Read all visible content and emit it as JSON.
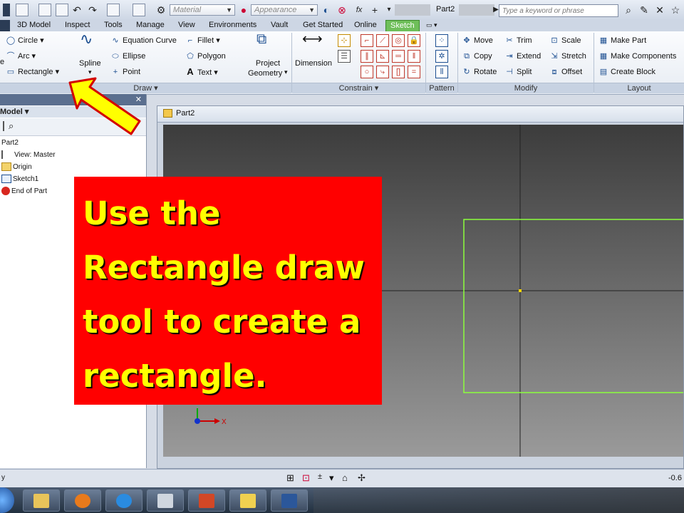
{
  "quick_access": {
    "material_placeholder": "Material",
    "appearance_placeholder": "Appearance",
    "document_title": "Part2",
    "search_placeholder": "Type a keyword or phrase",
    "fx_label": "fx"
  },
  "tabs": [
    {
      "label": "3D Model"
    },
    {
      "label": "Inspect"
    },
    {
      "label": "Tools"
    },
    {
      "label": "Manage"
    },
    {
      "label": "View"
    },
    {
      "label": "Environments"
    },
    {
      "label": "Vault"
    },
    {
      "label": "Get Started"
    },
    {
      "label": "Online"
    },
    {
      "label": "Sketch"
    }
  ],
  "ribbon": {
    "draw": {
      "e_label": "e",
      "circle": "Circle",
      "arc": "Arc",
      "rectangle": "Rectangle",
      "spline": "Spline",
      "equation_curve": "Equation Curve",
      "ellipse": "Ellipse",
      "point": "Point",
      "fillet": "Fillet",
      "polygon": "Polygon",
      "text": "Text",
      "project_geometry_line1": "Project",
      "project_geometry_line2": "Geometry",
      "panel_label": "Draw"
    },
    "constrain": {
      "dimension": "Dimension",
      "panel_label": "Constrain"
    },
    "pattern": {
      "panel_label": "Pattern"
    },
    "modify": {
      "move": "Move",
      "copy": "Copy",
      "rotate": "Rotate",
      "trim": "Trim",
      "extend": "Extend",
      "split": "Split",
      "scale": "Scale",
      "stretch": "Stretch",
      "offset": "Offset",
      "panel_label": "Modify"
    },
    "layout": {
      "make_part": "Make Part",
      "make_components": "Make Components",
      "create_block": "Create Block",
      "panel_label": "Layout"
    }
  },
  "browser": {
    "title": "Model",
    "tree": [
      {
        "label": "Part2"
      },
      {
        "label": "View: Master"
      },
      {
        "label": "Origin"
      },
      {
        "label": "Sketch1"
      },
      {
        "label": "End of Part"
      }
    ]
  },
  "graphics": {
    "window_title": "Part2",
    "axis_x_label": "X"
  },
  "status": {
    "coordinate_readout": "-0.6"
  },
  "callout": {
    "line1": "Use the",
    "line2": "Rectangle draw",
    "line3": "tool to create a",
    "line4": "rectangle."
  },
  "colors": {
    "callout_bg": "#ff0000",
    "callout_text": "#ffff00",
    "arrow_fill": "#ffff00",
    "arrow_outline": "#d40000",
    "sketch_rect": "#8cff3c",
    "active_tab": "#6fbf5a"
  }
}
